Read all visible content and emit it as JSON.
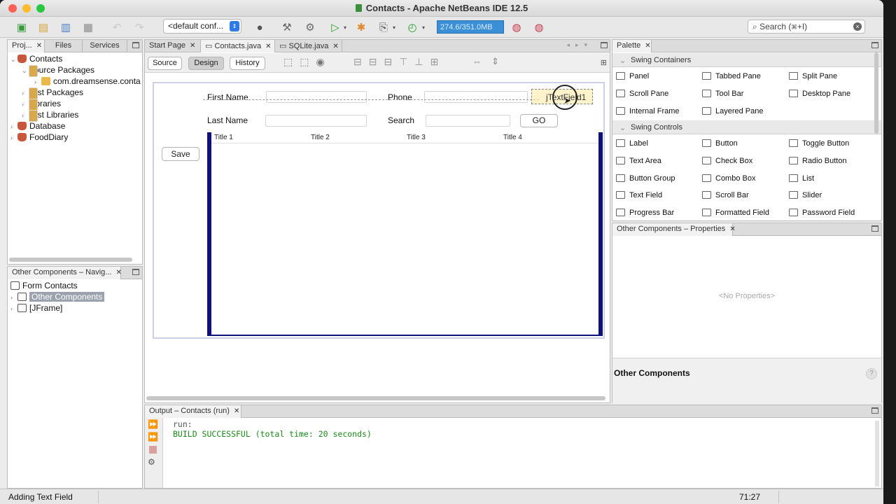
{
  "window": {
    "title": "Contacts - Apache NetBeans IDE 12.5"
  },
  "toolbar": {
    "config": "<default conf...",
    "memory": "274.6/351.0MB",
    "search_placeholder": "Search (⌘+I)",
    "icons": [
      "new-file-icon",
      "new-project-icon",
      "open-project-icon",
      "save-all-icon",
      "undo-icon",
      "redo-icon",
      "config-icon",
      "clean-build-icon",
      "build-icon",
      "run-icon",
      "debug-icon",
      "profile-icon",
      "gc-icon",
      "memory-monitor-icon"
    ]
  },
  "projects": {
    "tabs": [
      "Proj...",
      "Files",
      "Services"
    ],
    "tree": [
      {
        "label": "Contacts",
        "icon": "cup",
        "level": 0,
        "expanded": true
      },
      {
        "label": "Source Packages",
        "icon": "folder",
        "level": 1,
        "expanded": true
      },
      {
        "label": "com.dreamsense.conta",
        "icon": "package",
        "level": 2,
        "expanded": false
      },
      {
        "label": "Test Packages",
        "icon": "folder",
        "level": 1,
        "expanded": false
      },
      {
        "label": "Libraries",
        "icon": "folder",
        "level": 1,
        "expanded": false
      },
      {
        "label": "Test Libraries",
        "icon": "folder",
        "level": 1,
        "expanded": false
      },
      {
        "label": "Database",
        "icon": "cup",
        "level": 0,
        "expanded": false
      },
      {
        "label": "FoodDiary",
        "icon": "cup",
        "level": 0,
        "expanded": false
      }
    ]
  },
  "navigator": {
    "tab": "Other Components – Navig...",
    "items": [
      "Form Contacts",
      "Other Components",
      "[JFrame]"
    ]
  },
  "editor": {
    "tabs": [
      "Start Page",
      "Contacts.java",
      "SQLite.java"
    ],
    "modes": [
      "Source",
      "Design",
      "History"
    ],
    "active_mode": "Design"
  },
  "form": {
    "first_name_label": "First Name",
    "phone_label": "Phone",
    "last_name_label": "Last Name",
    "search_label": "Search",
    "go_button": "GO",
    "save_button": "Save",
    "drag_text": "jTextField1",
    "table_headers": [
      "Title 1",
      "Title 2",
      "Title 3",
      "Title 4"
    ]
  },
  "palette": {
    "tab": "Palette",
    "sections": [
      {
        "name": "Swing Containers",
        "items": [
          "Panel",
          "Tabbed Pane",
          "Split Pane",
          "Scroll Pane",
          "Tool Bar",
          "Desktop Pane",
          "Internal Frame",
          "Layered Pane"
        ]
      },
      {
        "name": "Swing Controls",
        "items": [
          "Label",
          "Button",
          "Toggle Button",
          "Text Area",
          "Check Box",
          "Radio Button",
          "Button Group",
          "Combo Box",
          "List",
          "Text Field",
          "Scroll Bar",
          "Slider",
          "Progress Bar",
          "Formatted Field",
          "Password Field"
        ]
      }
    ]
  },
  "properties": {
    "tab": "Other Components – Properties",
    "empty": "<No Properties>",
    "footer": "Other Components",
    "help": "?"
  },
  "output": {
    "tab": "Output – Contacts (run)",
    "lines": [
      "run:",
      "BUILD SUCCESSFUL (total time: 20 seconds)"
    ]
  },
  "status": {
    "message": "Adding Text Field",
    "position": "71:27"
  }
}
